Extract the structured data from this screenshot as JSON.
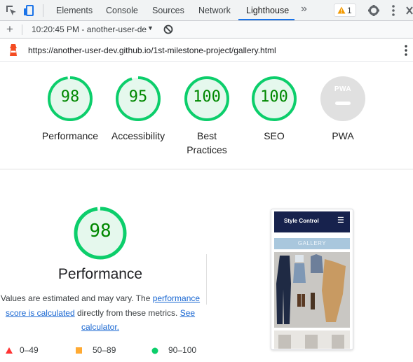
{
  "devtools": {
    "tabs": [
      {
        "label": "Elements"
      },
      {
        "label": "Console"
      },
      {
        "label": "Sources"
      },
      {
        "label": "Network"
      },
      {
        "label": "Lighthouse",
        "active": true
      }
    ],
    "more_tabs_glyph": "»",
    "warnings_count": "1"
  },
  "toolbar": {
    "add_glyph": "+",
    "report_label": "10:20:45 PM - another-user-de",
    "report_caret": "▼"
  },
  "url_bar": {
    "url": "https://another-user-dev.github.io/1st-milestone-project/gallery.html"
  },
  "categories": [
    {
      "name": "Performance",
      "score": "98"
    },
    {
      "name": "Accessibility",
      "score": "95"
    },
    {
      "name": "Best Practices",
      "score": "100"
    },
    {
      "name": "SEO",
      "score": "100"
    },
    {
      "name": "PWA",
      "score": null,
      "badge": "PWA"
    }
  ],
  "performance": {
    "score": "98",
    "title": "Performance",
    "desc_before": "Values are estimated and may vary. The ",
    "link_score": "performance score is calculated",
    "desc_mid": " directly from these metrics. ",
    "link_calc": "See calculator."
  },
  "legend": [
    {
      "range": "0–49",
      "color": "#ff3333",
      "shape": "triangle"
    },
    {
      "range": "50–89",
      "color": "#ffaa33",
      "shape": "square"
    },
    {
      "range": "90–100",
      "color": "#0cce6b",
      "shape": "circle"
    }
  ],
  "screenshot": {
    "brand": "Style Control",
    "menu_glyph": "☰",
    "banner": "GALLERY"
  },
  "colors": {
    "pass": "#0cce6b",
    "pass_text": "#008800",
    "link": "#1967d2",
    "tab_accent": "#1a73e8",
    "warning": "#f29900"
  }
}
